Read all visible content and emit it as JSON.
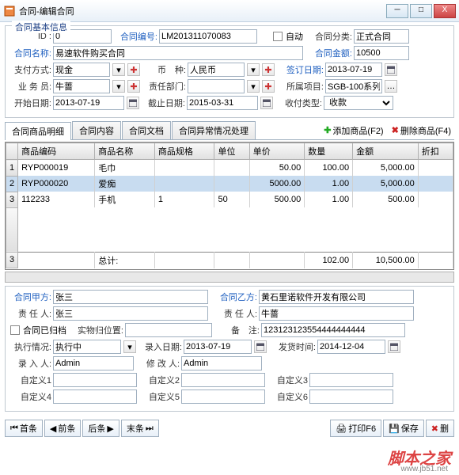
{
  "window": {
    "title": "合同-编辑合同",
    "min": "─",
    "max": "□",
    "close": "X"
  },
  "basic": {
    "title": "合同基本信息",
    "id_lbl": "ID :",
    "id": "0",
    "no_lbl": "合同编号:",
    "no": "LM201311070083",
    "auto_lbl": "自动",
    "cat_lbl": "合同分类:",
    "cat": "正式合同",
    "name_lbl": "合同名称:",
    "name": "易速软件购买合同",
    "amt_lbl": "合同金额:",
    "amt": "10500",
    "pay_lbl": "支付方式:",
    "pay": "现金",
    "cur_lbl": "币　种:",
    "cur": "人民币",
    "sign_lbl": "签订日期:",
    "sign": "2013-07-19",
    "sales_lbl": "业 务 员:",
    "sales": "牛蔷",
    "dept_lbl": "责任部门:",
    "dept": "",
    "proj_lbl": "所属项目:",
    "proj": "SGB-100系列",
    "start_lbl": "开始日期:",
    "start": "2013-07-19",
    "end_lbl": "截止日期:",
    "end": "2015-03-31",
    "rcvtype_lbl": "收付类型:",
    "rcvtype": "收款"
  },
  "tabs": {
    "t1": "合同商品明细",
    "t2": "合同内容",
    "t3": "合同文档",
    "t4": "合同异常情况处理"
  },
  "gridbtns": {
    "add": "添加商品(F2)",
    "del": "删除商品(F4)"
  },
  "grid": {
    "cols": [
      "商品编码",
      "商品名称",
      "商品规格",
      "单位",
      "单价",
      "数量",
      "金额",
      "折扣"
    ],
    "rows": [
      {
        "n": "1",
        "code": "RYP000019",
        "name": "毛巾",
        "spec": "",
        "unit": "",
        "price": "50.00",
        "qty": "100.00",
        "amt": "5,000.00",
        "disc": ""
      },
      {
        "n": "2",
        "code": "RYP000020",
        "name": "爱痴",
        "spec": "",
        "unit": "",
        "price": "5000.00",
        "qty": "1.00",
        "amt": "5,000.00",
        "disc": ""
      },
      {
        "n": "3",
        "code": "112233",
        "name": "手机",
        "spec": "1",
        "unit": "50",
        "price": "500.00",
        "qty": "1.00",
        "amt": "500.00",
        "disc": ""
      }
    ],
    "sum_lbl": "总计:",
    "sum_qty": "102.00",
    "sum_amt": "10,500.00",
    "sumrow": "3"
  },
  "party": {
    "a_lbl": "合同甲方:",
    "a": "张三",
    "b_lbl": "合同乙方:",
    "b": "黄石里诺软件开发有限公司",
    "ra_lbl": "责 任 人:",
    "ra": "张三",
    "rb_lbl": "责 任 人:",
    "rb": "牛蔷",
    "arch_lbl": "合同已归档",
    "loc_lbl": "实物归位置:",
    "loc": "",
    "note_lbl": "备　注:",
    "note": "123123123554444444444",
    "exec_lbl": "执行情况:",
    "exec": "执行中",
    "indate_lbl": "录入日期:",
    "indate": "2013-07-19",
    "ship_lbl": "发货时间:",
    "ship": "2014-12-04",
    "inby_lbl": "录 入 人:",
    "inby": "Admin",
    "modby_lbl": "修 改 人:",
    "modby": "Admin",
    "c1_lbl": "自定义1",
    "c2_lbl": "自定义2",
    "c3_lbl": "自定义3",
    "c4_lbl": "自定义4",
    "c5_lbl": "自定义5",
    "c6_lbl": "自定义6"
  },
  "nav": {
    "first": "首条",
    "prev": "前条",
    "next": "后条",
    "last": "末条",
    "print": "打印F6",
    "save": "保存",
    "del": "删"
  },
  "wm": {
    "t": "脚本之家",
    "u": "www.jb51.net"
  }
}
